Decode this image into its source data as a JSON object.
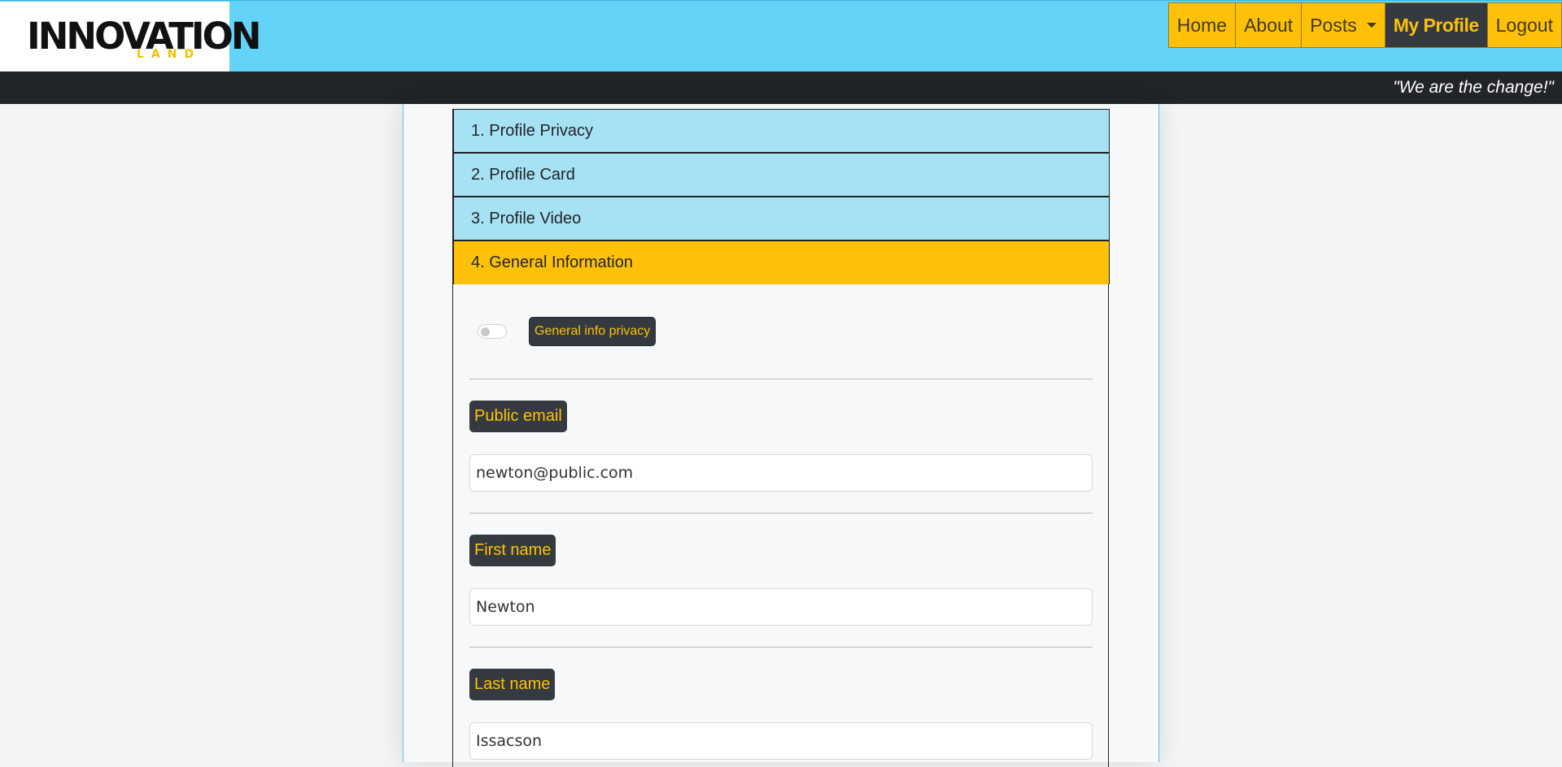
{
  "brand": {
    "logo_main": "INNOVATION",
    "logo_sub": "LAND",
    "tagline": "\"We are the change!\""
  },
  "nav": {
    "items": [
      {
        "label": "Home",
        "active": false
      },
      {
        "label": "About",
        "active": false
      },
      {
        "label": "Posts",
        "active": false,
        "dropdown": true
      },
      {
        "label": "My Profile",
        "active": true
      },
      {
        "label": "Logout",
        "active": false
      }
    ]
  },
  "accordion": {
    "sections": [
      {
        "label": "1. Profile Privacy",
        "open": false
      },
      {
        "label": "2. Profile Card",
        "open": false
      },
      {
        "label": "3. Profile Video",
        "open": false
      },
      {
        "label": "4. General Information",
        "open": true
      }
    ]
  },
  "general_info": {
    "privacy_toggle_on": false,
    "privacy_label": "General info privacy",
    "fields": [
      {
        "label": "Public email",
        "value": "newton@public.com"
      },
      {
        "label": "First name",
        "value": "Newton"
      },
      {
        "label": "Last name",
        "value": "Issacson"
      }
    ]
  },
  "colors": {
    "navbar_bg": "#63d3f8",
    "accent_yellow": "#ffc108",
    "dark": "#343a40",
    "accordion_collapsed": "#a7e1f4"
  }
}
